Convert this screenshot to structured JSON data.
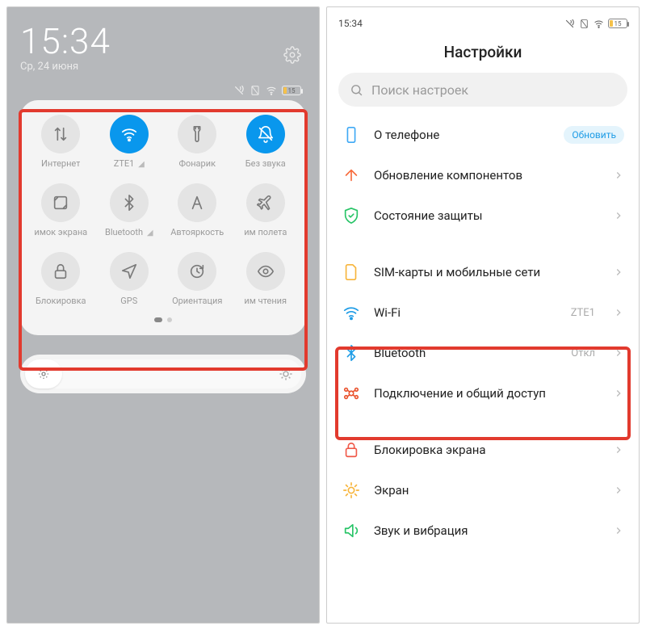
{
  "left": {
    "time": "15:34",
    "date": "Ср, 24 июня",
    "battery": "15",
    "tiles": [
      {
        "id": "internet",
        "label": "Интернет",
        "icon": "data-arrows",
        "on": false
      },
      {
        "id": "wifi",
        "label": "ZTE1",
        "icon": "wifi",
        "on": true,
        "signal": true
      },
      {
        "id": "flashlight",
        "label": "Фонарик",
        "icon": "flashlight",
        "on": false
      },
      {
        "id": "mute",
        "label": "Без звука",
        "icon": "bell-off",
        "on": true
      },
      {
        "id": "screenshot",
        "label": "имок экрана",
        "icon": "screenshot",
        "on": false
      },
      {
        "id": "bluetooth",
        "label": "Bluetooth",
        "icon": "bluetooth",
        "on": false,
        "signal": true
      },
      {
        "id": "autobright",
        "label": "Автояркость",
        "icon": "letter-a",
        "on": false
      },
      {
        "id": "airplane",
        "label": "им полета",
        "icon": "airplane",
        "on": false
      },
      {
        "id": "lock",
        "label": "Блокировка",
        "icon": "lock",
        "on": false
      },
      {
        "id": "gps",
        "label": "GPS",
        "icon": "nav-arrow",
        "on": false
      },
      {
        "id": "orientation",
        "label": "Ориентация",
        "icon": "rotate-lock",
        "on": false
      },
      {
        "id": "reading",
        "label": "им чтения",
        "icon": "eye",
        "on": false
      }
    ]
  },
  "right": {
    "time": "15:34",
    "battery": "15",
    "title": "Настройки",
    "search_placeholder": "Поиск настроек",
    "items": [
      {
        "id": "about",
        "label": "О телефоне",
        "icon": "phone",
        "color": "#3FA9F5",
        "badge": "Обновить"
      },
      {
        "id": "components",
        "label": "Обновление компонентов",
        "icon": "arrow-up",
        "color": "#F76B3C",
        "chev": true
      },
      {
        "id": "security",
        "label": "Состояние защиты",
        "icon": "shield",
        "color": "#28C467",
        "chev": true
      },
      {
        "id": "sim",
        "label": "SIM-карты и мобильные сети",
        "icon": "sim",
        "color": "#F7B53C",
        "chev": true,
        "gap": true
      },
      {
        "id": "wifi",
        "label": "Wi-Fi",
        "icon": "wifi",
        "color": "#1E9CE6",
        "value": "ZTE1",
        "chev": true
      },
      {
        "id": "bluetooth",
        "label": "Bluetooth",
        "icon": "bluetooth",
        "color": "#1E9CE6",
        "value": "Откл",
        "chev": true
      },
      {
        "id": "tether",
        "label": "Подключение и общий доступ",
        "icon": "share",
        "color": "#EA5530",
        "chev": true
      },
      {
        "id": "lockscreen",
        "label": "Блокировка экрана",
        "icon": "lock-sq",
        "color": "#F05A4A",
        "chev": true,
        "gap": true
      },
      {
        "id": "display",
        "label": "Экран",
        "icon": "sun",
        "color": "#F7B53C",
        "chev": true
      },
      {
        "id": "sound",
        "label": "Звук и вибрация",
        "icon": "sound",
        "color": "#28C467",
        "chev": true
      }
    ]
  }
}
